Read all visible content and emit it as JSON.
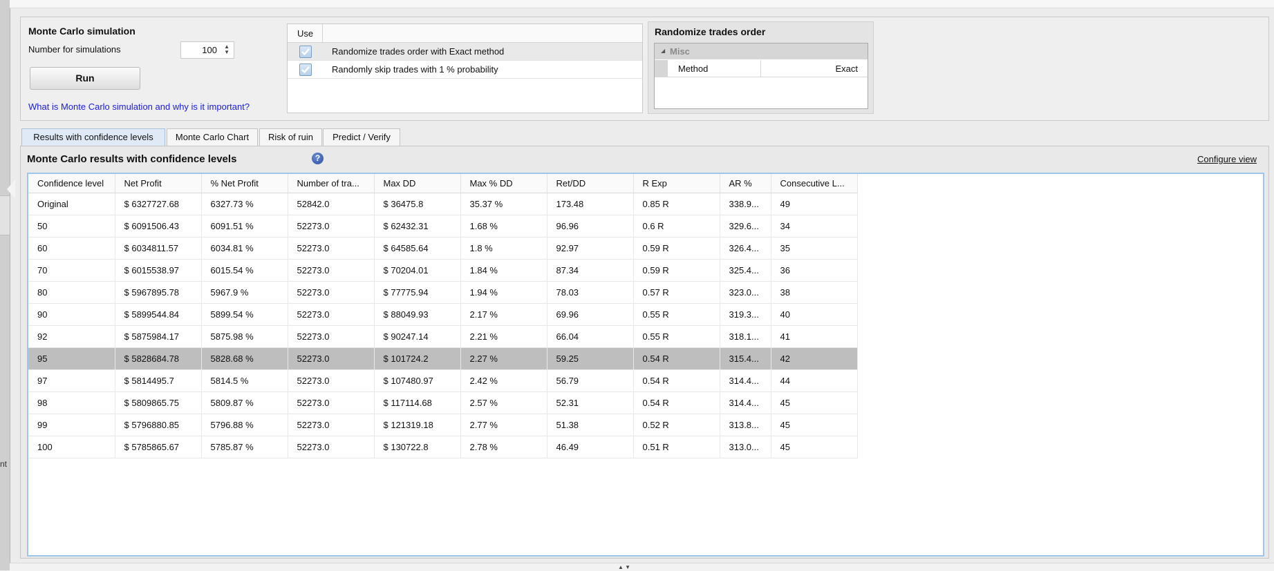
{
  "left_edge_fragment": "nt",
  "monte_carlo": {
    "title": "Monte Carlo simulation",
    "num_label": "Number for simulations",
    "num_value": "100",
    "run_label": "Run",
    "link": "What is Monte Carlo simulation and why is it important?"
  },
  "options": {
    "use_header": "Use",
    "rows": [
      {
        "checked": true,
        "label": "Randomize trades order with Exact method"
      },
      {
        "checked": true,
        "label": "Randomly skip trades with 1 % probability"
      }
    ]
  },
  "randomize": {
    "title": "Randomize trades order",
    "category": "Misc",
    "property_name": "Method",
    "property_value": "Exact"
  },
  "tabs": [
    {
      "label": "Results with confidence levels",
      "active": true
    },
    {
      "label": "Monte Carlo Chart",
      "active": false
    },
    {
      "label": "Risk of ruin",
      "active": false
    },
    {
      "label": "Predict / Verify",
      "active": false
    }
  ],
  "results": {
    "title": "Monte Carlo results with confidence levels",
    "configure": "Configure view",
    "columns": [
      "Confidence level",
      "Net Profit",
      "% Net Profit",
      "Number of tra...",
      "Max DD",
      "Max % DD",
      "Ret/DD",
      "R Exp",
      "AR %",
      "Consecutive L..."
    ],
    "selected_row": 7,
    "rows": [
      [
        "Original",
        "$ 6327727.68",
        "6327.73 %",
        "52842.0",
        "$ 36475.8",
        "35.37 %",
        "173.48",
        "0.85 R",
        "338.9...",
        "49"
      ],
      [
        "50",
        "$ 6091506.43",
        "6091.51 %",
        "52273.0",
        "$ 62432.31",
        "1.68 %",
        "96.96",
        "0.6 R",
        "329.6...",
        "34"
      ],
      [
        "60",
        "$ 6034811.57",
        "6034.81 %",
        "52273.0",
        "$ 64585.64",
        "1.8 %",
        "92.97",
        "0.59 R",
        "326.4...",
        "35"
      ],
      [
        "70",
        "$ 6015538.97",
        "6015.54 %",
        "52273.0",
        "$ 70204.01",
        "1.84 %",
        "87.34",
        "0.59 R",
        "325.4...",
        "36"
      ],
      [
        "80",
        "$ 5967895.78",
        "5967.9 %",
        "52273.0",
        "$ 77775.94",
        "1.94 %",
        "78.03",
        "0.57 R",
        "323.0...",
        "38"
      ],
      [
        "90",
        "$ 5899544.84",
        "5899.54 %",
        "52273.0",
        "$ 88049.93",
        "2.17 %",
        "69.96",
        "0.55 R",
        "319.3...",
        "40"
      ],
      [
        "92",
        "$ 5875984.17",
        "5875.98 %",
        "52273.0",
        "$ 90247.14",
        "2.21 %",
        "66.04",
        "0.55 R",
        "318.1...",
        "41"
      ],
      [
        "95",
        "$ 5828684.78",
        "5828.68 %",
        "52273.0",
        "$ 101724.2",
        "2.27 %",
        "59.25",
        "0.54 R",
        "315.4...",
        "42"
      ],
      [
        "97",
        "$ 5814495.7",
        "5814.5 %",
        "52273.0",
        "$ 107480.97",
        "2.42 %",
        "56.79",
        "0.54 R",
        "314.4...",
        "44"
      ],
      [
        "98",
        "$ 5809865.75",
        "5809.87 %",
        "52273.0",
        "$ 117114.68",
        "2.57 %",
        "52.31",
        "0.54 R",
        "314.4...",
        "45"
      ],
      [
        "99",
        "$ 5796880.85",
        "5796.88 %",
        "52273.0",
        "$ 121319.18",
        "2.77 %",
        "51.38",
        "0.52 R",
        "313.8...",
        "45"
      ],
      [
        "100",
        "$ 5785865.67",
        "5785.87 %",
        "52273.0",
        "$ 130722.8",
        "2.78 %",
        "46.49",
        "0.51 R",
        "313.0...",
        "45"
      ]
    ]
  }
}
